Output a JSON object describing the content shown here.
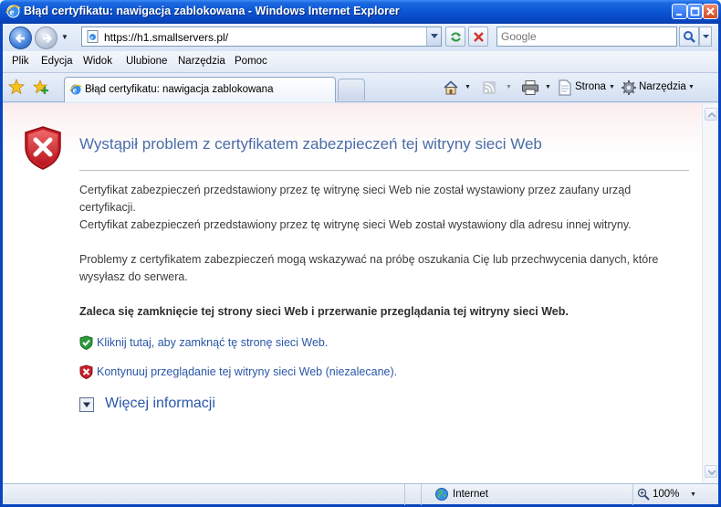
{
  "window": {
    "title": "Błąd certyfikatu: nawigacja zablokowana - Windows Internet Explorer"
  },
  "address_bar": {
    "url": "https://h1.smallservers.pl/"
  },
  "search": {
    "placeholder": "Google"
  },
  "menu": {
    "items": [
      {
        "label": "Plik"
      },
      {
        "label": "Edycja"
      },
      {
        "label": "Widok"
      },
      {
        "label": "Ulubione"
      },
      {
        "label": "Narzędzia"
      },
      {
        "label": "Pomoc"
      }
    ]
  },
  "tab": {
    "label": "Błąd certyfikatu: nawigacja zablokowana"
  },
  "command_bar": {
    "page_label": "Strona",
    "tools_label": "Narzędzia"
  },
  "content": {
    "title": "Wystąpił problem z certyfikatem zabezpieczeń tej witryny sieci Web",
    "para1": "Certyfikat zabezpieczeń przedstawiony przez tę witrynę sieci Web nie został wystawiony przez zaufany urząd certyfikacji.",
    "para2": "Certyfikat zabezpieczeń przedstawiony przez tę witrynę sieci Web został wystawiony dla adresu innej witryny.",
    "para3": "Problemy z certyfikatem zabezpieczeń mogą wskazywać na próbę oszukania Cię lub przechwycenia danych, które wysyłasz do serwera.",
    "recommendation": "Zaleca się zamknięcie tej strony sieci Web i przerwanie przeglądania tej witryny sieci Web.",
    "close_link": "Kliknij tutaj, aby zamknąć tę stronę sieci Web.",
    "continue_link": "Kontynuuj przeglądanie tej witryny sieci Web (niezalecane).",
    "more_info": "Więcej informacji"
  },
  "status_bar": {
    "zone": "Internet",
    "zoom": "100%"
  },
  "colors": {
    "title_bar": "#0a55d4",
    "link": "#2a57a8",
    "heading": "#4a6da8",
    "error_red": "#c8202a",
    "safe_green": "#2e9a3a"
  }
}
